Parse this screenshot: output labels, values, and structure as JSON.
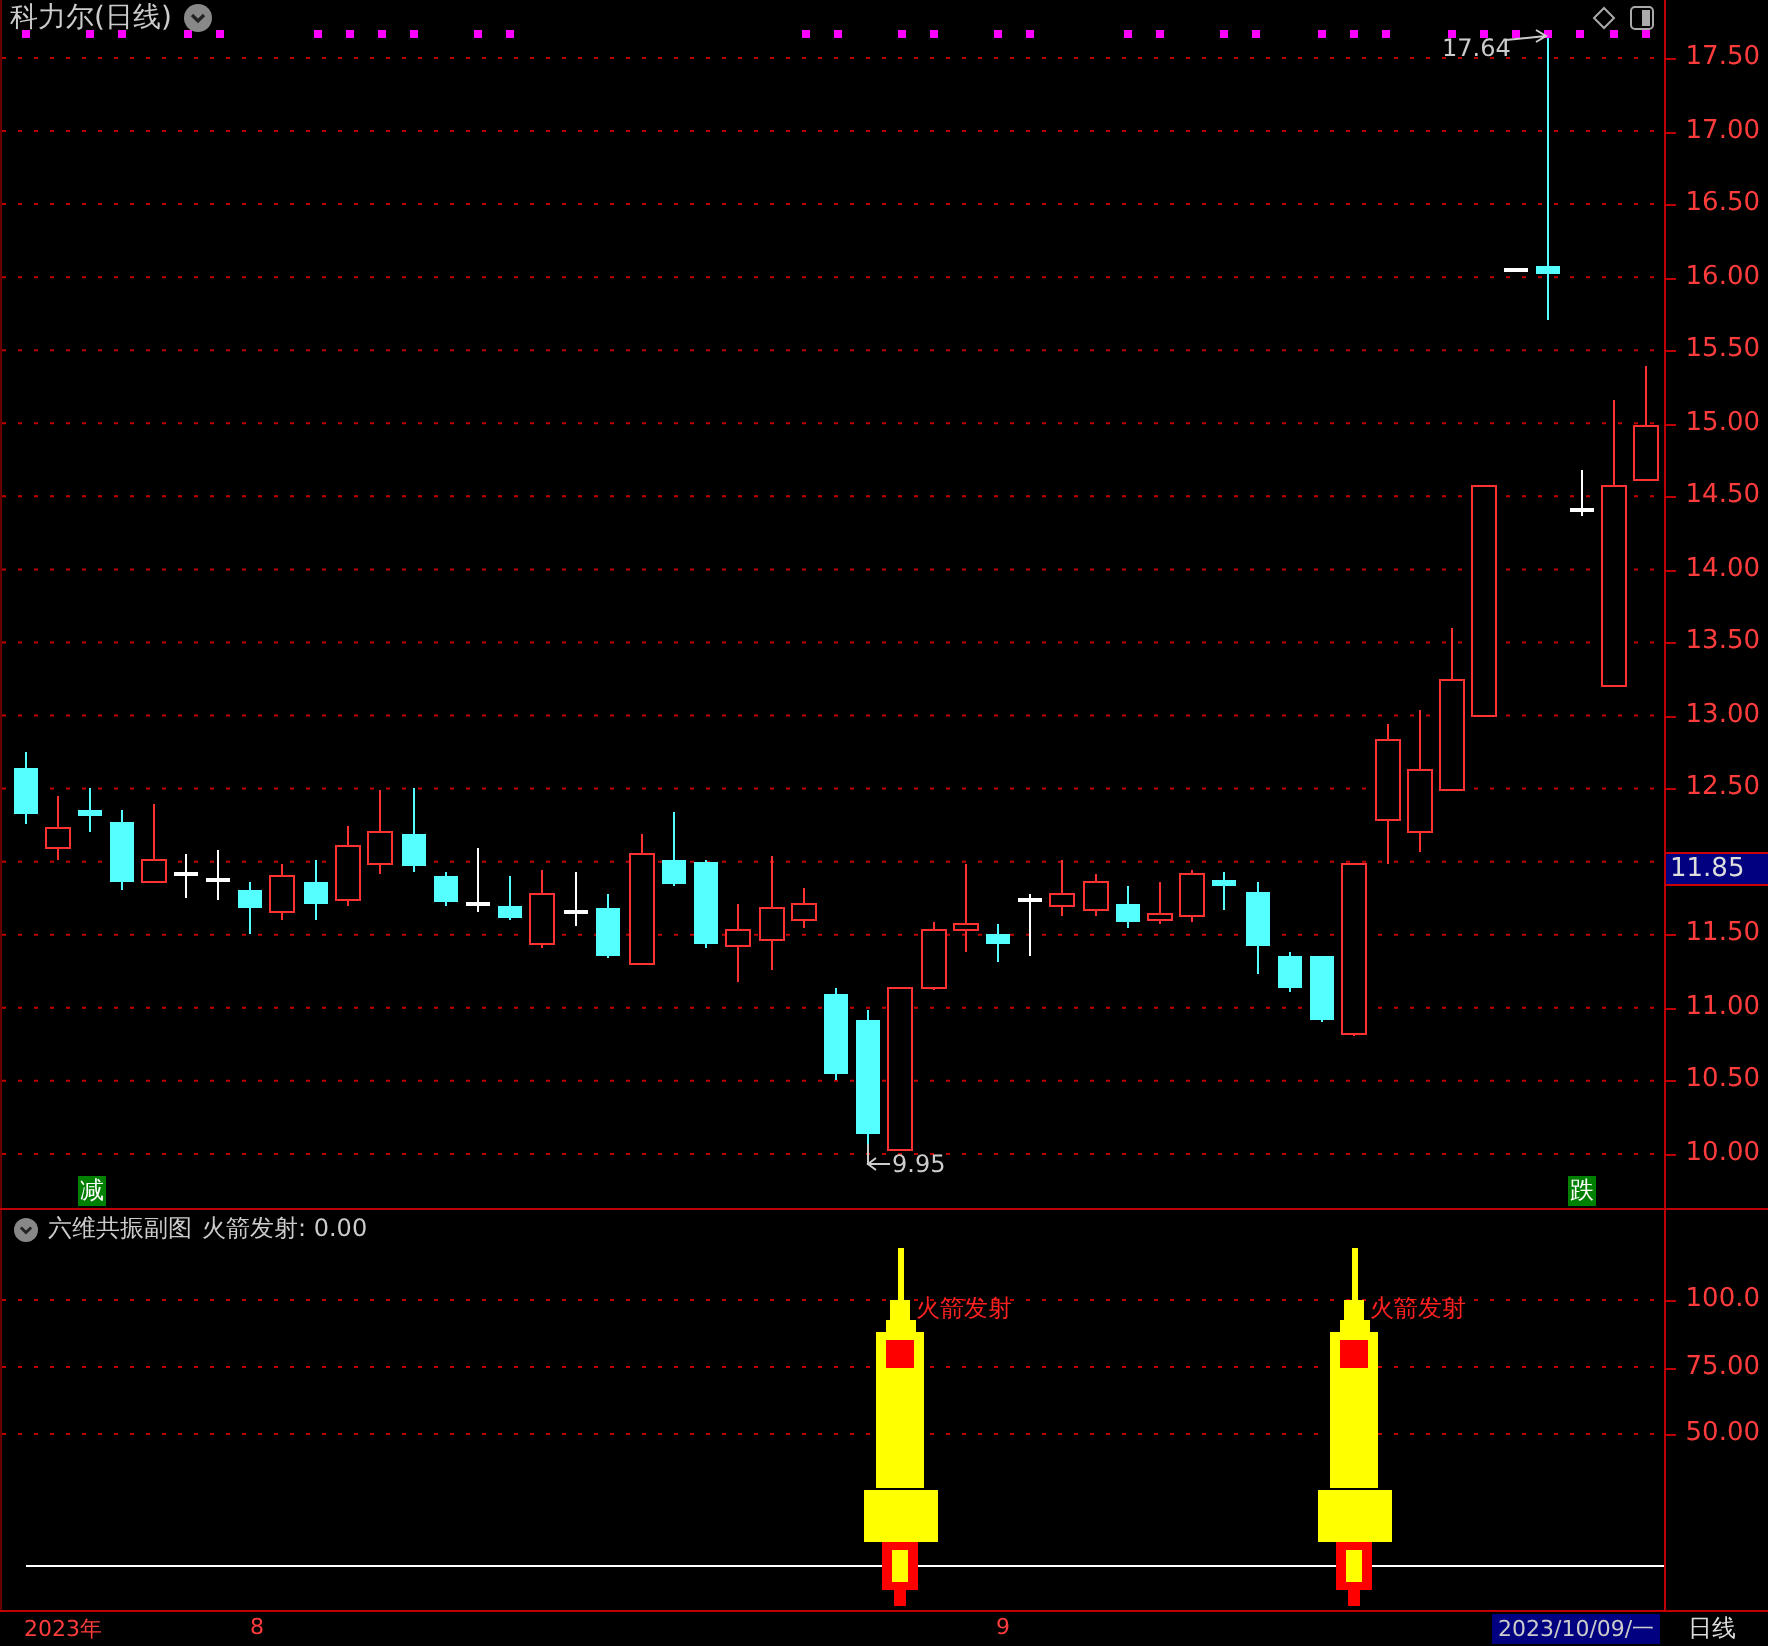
{
  "header": {
    "title": "科力尔(日线)"
  },
  "price_chart": {
    "high_marker": "17.64",
    "low_marker": "9.95",
    "signals": [
      "减",
      "跌"
    ],
    "axis_labels": [
      "17.50",
      "17.00",
      "16.50",
      "16.00",
      "15.50",
      "15.00",
      "14.50",
      "14.00",
      "13.50",
      "13.00",
      "12.50",
      "11.50",
      "11.00",
      "10.50",
      "10.00"
    ],
    "current_price": "11.85"
  },
  "indicator_panel": {
    "title": "六维共振副图",
    "value_label": "火箭发射: 0.00",
    "rocket_labels": [
      "火箭发射",
      "火箭发射"
    ],
    "axis_labels": [
      "100.0",
      "75.00",
      "50.00"
    ]
  },
  "time_axis": {
    "labels": [
      "2023年",
      "8",
      "9"
    ],
    "cursor_date": "2023/10/09/一",
    "period": "日线"
  }
}
